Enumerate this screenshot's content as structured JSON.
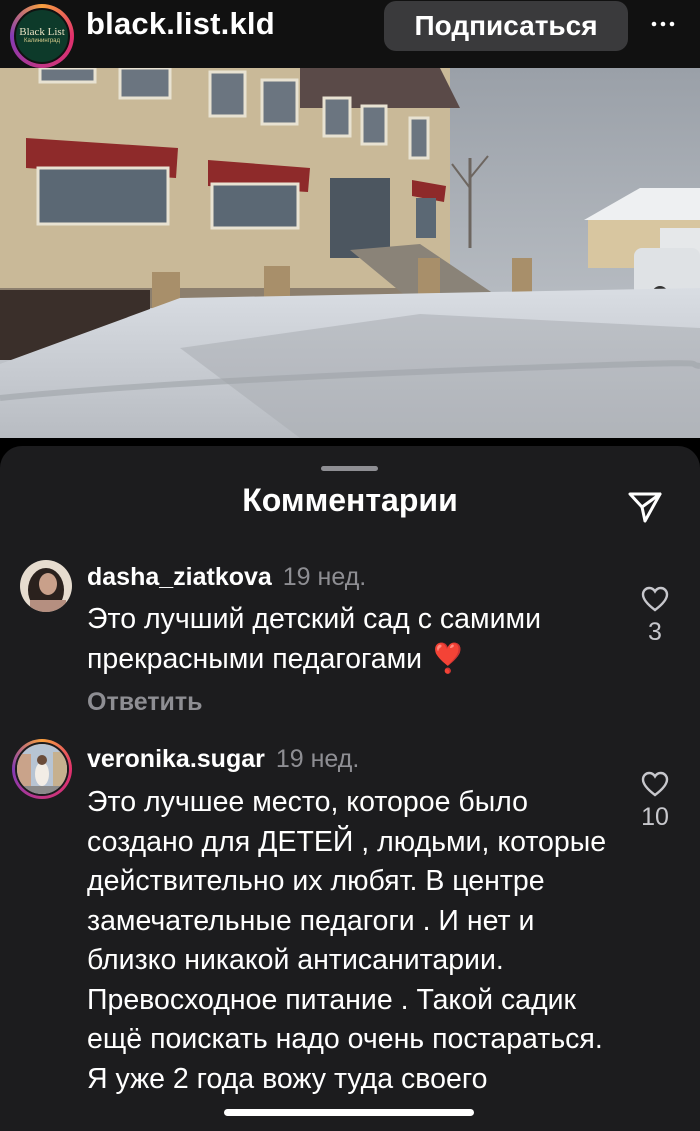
{
  "header": {
    "account_name": "black.list.kld",
    "logo_text": "Black List",
    "logo_subtext": "Калининград",
    "follow_label": "Подписаться",
    "more_icon": "ellipsis-icon"
  },
  "post": {
    "image_description_icon": "post-photo"
  },
  "comments_sheet": {
    "title": "Комментарии",
    "send_icon": "paper-plane-icon",
    "comments": [
      {
        "username": "dasha_ziatkova",
        "time": "19 нед.",
        "text": "Это лучший детский сад с самими прекрасными педагогами ❣️",
        "reply_label": "Ответить",
        "likes": "3"
      },
      {
        "username": "veronika.sugar",
        "time": "19 нед.",
        "text": "Это лучшее место, которое было создано для ДЕТЕЙ , людьми, которые действительно их любят. В центре замечательные педагоги . И нет и близко никакой антисанитарии. Превосходное питание . Такой садик ещё поискать надо очень постараться. Я уже 2 года вожу туда своего",
        "likes": "10"
      }
    ]
  },
  "colors": {
    "background": "#000000",
    "sheet": "#1c1c1e",
    "button": "#3a3a3c",
    "muted_text": "#8e8e93"
  }
}
